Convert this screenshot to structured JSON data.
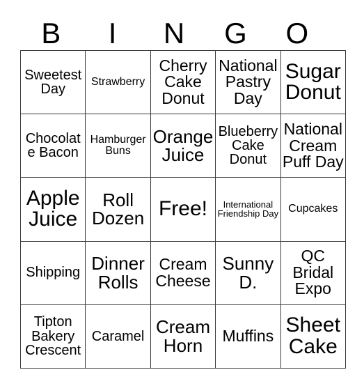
{
  "card": {
    "header_letters": [
      "B",
      "I",
      "N",
      "G",
      "O"
    ],
    "columns": 5,
    "rows": 5,
    "free_space_label": "Free!",
    "border_color": "#3a3a3a",
    "background_color": "#ffffff",
    "text_color": "#000000",
    "grid": [
      [
        {
          "text": "Sweetest Day",
          "size": "md"
        },
        {
          "text": "Strawberry",
          "size": "sm"
        },
        {
          "text": "Cherry Cake Donut",
          "size": "lg"
        },
        {
          "text": "National Pastry Day",
          "size": "lg"
        },
        {
          "text": "Sugar Donut",
          "size": "xxl"
        }
      ],
      [
        {
          "text": "Chocolate Bacon",
          "size": "md"
        },
        {
          "text": "Hamburger Buns",
          "size": "sm"
        },
        {
          "text": "Orange Juice",
          "size": "xl"
        },
        {
          "text": "Blueberry Cake Donut",
          "size": "md"
        },
        {
          "text": "National Cream Puff Day",
          "size": "lg"
        }
      ],
      [
        {
          "text": "Apple Juice",
          "size": "xxl"
        },
        {
          "text": "Roll Dozen",
          "size": "xl"
        },
        {
          "text": "Free!",
          "size": "xxl"
        },
        {
          "text": "International Friendship Day",
          "size": "xs"
        },
        {
          "text": "Cupcakes",
          "size": "sm"
        }
      ],
      [
        {
          "text": "Shipping",
          "size": "md"
        },
        {
          "text": "Dinner Rolls",
          "size": "xl"
        },
        {
          "text": "Cream Cheese",
          "size": "lg"
        },
        {
          "text": "Sunny D.",
          "size": "xl"
        },
        {
          "text": "QC Bridal Expo",
          "size": "lg"
        }
      ],
      [
        {
          "text": "Tipton Bakery Crescent",
          "size": "md"
        },
        {
          "text": "Caramel",
          "size": "md"
        },
        {
          "text": "Cream Horn",
          "size": "xl"
        },
        {
          "text": "Muffins",
          "size": "lg"
        },
        {
          "text": "Sheet Cake",
          "size": "xxl"
        }
      ]
    ]
  }
}
